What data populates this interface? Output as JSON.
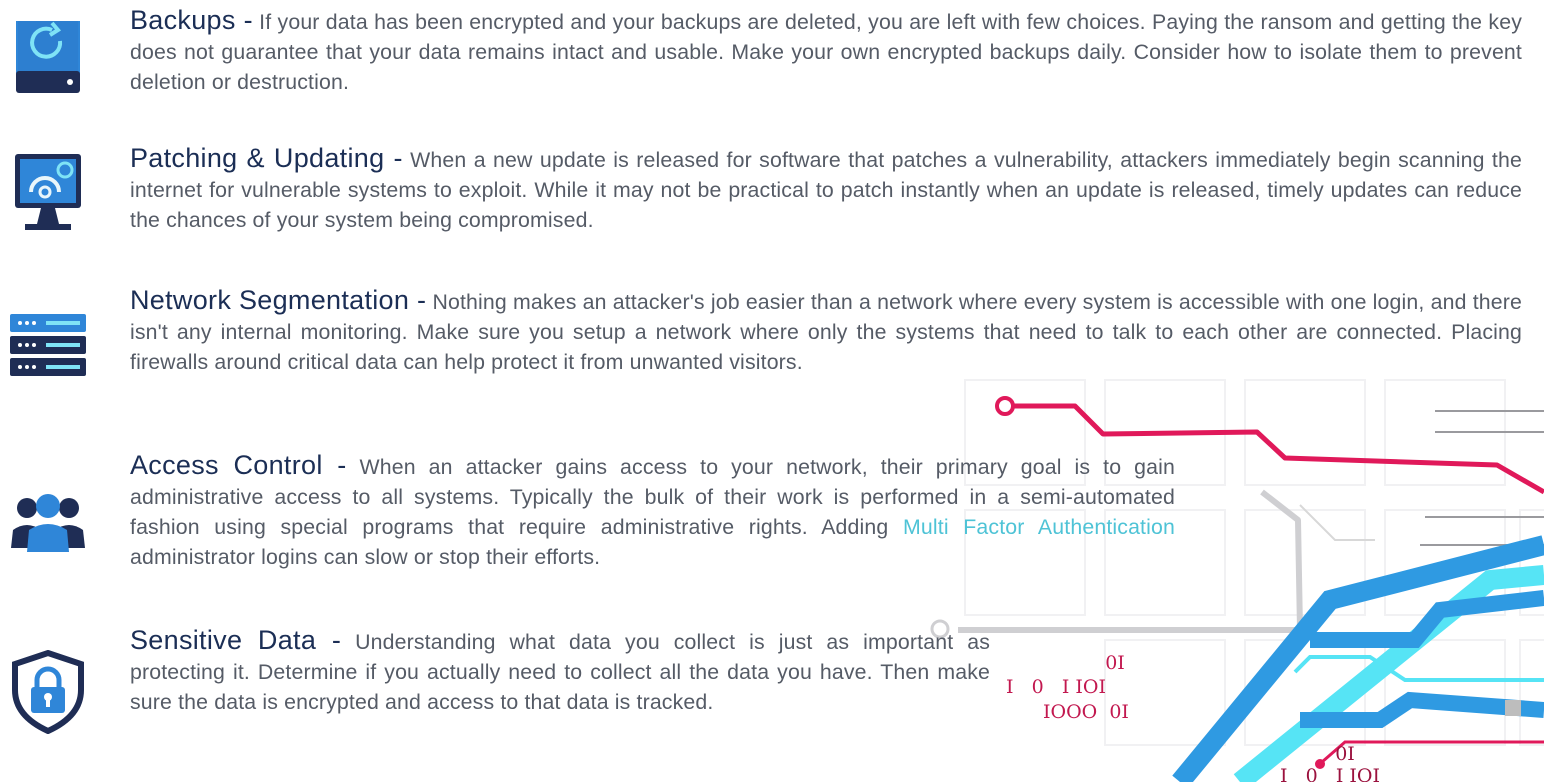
{
  "colors": {
    "heading": "#1b2e55",
    "body_text": "#555b66",
    "link": "#4ec3d6",
    "icon_navy": "#1f2d55",
    "icon_blue": "#2f86d8",
    "icon_cyan": "#5ad8f0",
    "circuit_red": "#e0195a",
    "circuit_gray": "#c8c8c8"
  },
  "items": [
    {
      "icon": "backup-drive-icon",
      "heading": "Backups -",
      "body": "If your data has been encrypted and your backups are deleted, you are left with few choices. Paying the ransom and getting the key does not guarantee that your data remains intact and usable. Make your own encrypted backups daily. Consider how to isolate them to prevent deletion or destruction."
    },
    {
      "icon": "monitor-gear-icon",
      "heading": "Patching & Updating -",
      "body": "When a new update is released for software that patches a vulnerability, attackers immediately begin scanning the internet for vulnerable systems to exploit. While it may not be practical to patch instantly when an update is released, timely updates can reduce the chances of your system being compromised."
    },
    {
      "icon": "server-rack-icon",
      "heading": "Network Segmentation -",
      "body": "Nothing makes an attacker's job easier than a network where every system is accessible with one login, and there isn't any internal monitoring. Make sure you setup a network where only the systems that need to talk to each other are connected. Placing firewalls around critical data can help protect it from unwanted visitors."
    },
    {
      "icon": "user-group-icon",
      "heading": "Access Control -",
      "body_before": "When an attacker gains access to your network, their primary goal is to gain administrative access to all systems. Typically the bulk of their work is performed in a semi-automated fashion using special programs that require administrative rights. Adding",
      "link": "Multi Factor Authentication",
      "body_after": "administrator logins can slow or stop their efforts."
    },
    {
      "icon": "shield-lock-icon",
      "heading": "Sensitive Data -",
      "body": "Understanding what data you collect is just as important as protecting it. Determine if you actually need to collect all the data you have. Then make sure the data is encrypted and access to that data is tracked."
    }
  ],
  "binary_block_1": [
    "0I",
    "I   0   I IOI",
    "IOOO  0I"
  ],
  "binary_block_2": [
    "0I",
    "I   0   I IOI"
  ]
}
